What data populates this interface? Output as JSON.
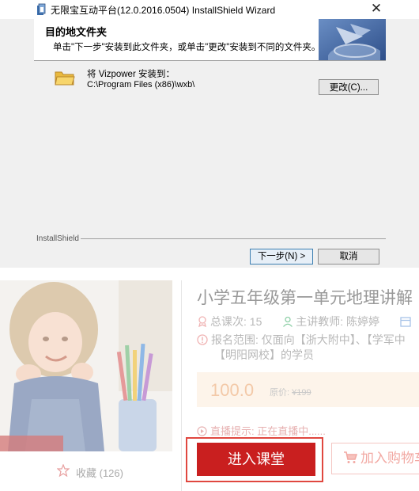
{
  "installer": {
    "title": "无限宝互动平台(12.0.2016.0504)  InstallShield Wizard",
    "close_symbol": "✕",
    "banner_heading": "目的地文件夹",
    "banner_description": "单击\"下一步\"安装到此文件夹，或单击\"更改\"安装到不同的文件夹。",
    "destination_label": "将 Vizpower 安装到：",
    "destination_path": "C:\\Program Files (x86)\\wxb\\",
    "change_button": "更改(C)...",
    "footer_brand": "InstallShield",
    "next_button": "下一步(N) >",
    "cancel_button": "取消",
    "icons": {
      "app": "installer-app-icon",
      "folder": "folder-icon",
      "banner": "installshield-logo-graphic"
    }
  },
  "course": {
    "title": "小学五年级第一单元地理讲解",
    "lesson_count": "总课次: 15",
    "teacher": "主讲教师: 陈婷婷",
    "scope_line1": "报名范围: 仅面向【浙大附中】、【学军中",
    "scope_line2": "【明阳网校】的学员",
    "price": "100.0",
    "original_price_label": "原价:",
    "original_price": "¥199",
    "live_notice": "直播提示: 正在直播中......",
    "enter_button": "进入课堂",
    "cart_button": "加入购物车",
    "favorite_label": "收藏 (126)",
    "icons": {
      "lessons": "calendar-icon",
      "teacher": "person-icon",
      "scope": "info-icon",
      "live": "play-circle-icon",
      "favorite": "star-icon",
      "cart": "cart-icon"
    },
    "colors": {
      "accent": "#c91f1f",
      "price": "#f3c9a8",
      "highlight_border": "#e0473f"
    }
  }
}
